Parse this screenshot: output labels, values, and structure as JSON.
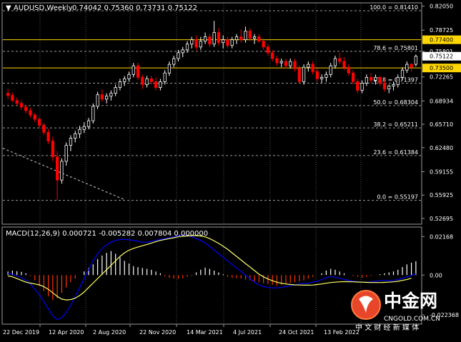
{
  "symbol_header": "AUDUSD,Weekly",
  "ohlc": "0.74042 0.75360 0.73731 0.75122",
  "fib_levels": [
    {
      "label": "100.0 = 0.81410",
      "price": 0.8141
    },
    {
      "label": "78.6 = 0.75801",
      "price": 0.75801
    },
    {
      "label": "61.8 = 0.71397",
      "price": 0.71397
    },
    {
      "label": "50.0 = 0.68304",
      "price": 0.68304
    },
    {
      "label": "38.2 = 0.65211",
      "price": 0.65211
    },
    {
      "label": "23.6 = 0.61384",
      "price": 0.61384
    },
    {
      "label": "0.0 = 0.55197",
      "price": 0.55197
    }
  ],
  "horizontal_lines": [
    {
      "price": 0.774,
      "tag": "0.77400"
    },
    {
      "price": 0.735,
      "tag": "0.73500"
    }
  ],
  "price_scale": [
    "0.82050",
    "0.78725",
    "0.75801",
    "0.72265",
    "0.68934",
    "0.65710",
    "0.62480",
    "0.59155",
    "0.55925",
    "0.52695"
  ],
  "current_price": "0.75122",
  "macd_header": "MACD(12,26,9) 0.000721 -0.005282 0.007804 0.000000",
  "macd_scale": [
    "0.02168",
    "0.00",
    "-0.022368"
  ],
  "time_labels": [
    "22 Dec 2019",
    "12 Apr 2020",
    "2 Aug 2020",
    "22 Nov 2020",
    "14 Mar 2021",
    "4 Jul 2021",
    "24 Oct 2021",
    "13 Feb 2022"
  ],
  "watermark": {
    "brand": "中金网",
    "site": "CNGOLD.COM.CN",
    "slogan": "中 文 财 经 新 媒 体"
  },
  "colors": {
    "bull": "#ffffff",
    "bear": "#ff0000",
    "level": "#ffd700",
    "macd_line": "#0000ff",
    "signal_line": "#ffff66",
    "grid": "#555555"
  },
  "chart_data": {
    "type": "candlestick",
    "candles": [
      [
        0.7,
        0.706,
        0.692,
        0.697
      ],
      [
        0.697,
        0.701,
        0.688,
        0.69
      ],
      [
        0.69,
        0.694,
        0.683,
        0.686
      ],
      [
        0.686,
        0.69,
        0.677,
        0.681
      ],
      [
        0.681,
        0.684,
        0.672,
        0.676
      ],
      [
        0.676,
        0.68,
        0.666,
        0.67
      ],
      [
        0.67,
        0.673,
        0.66,
        0.664
      ],
      [
        0.664,
        0.667,
        0.652,
        0.656
      ],
      [
        0.656,
        0.659,
        0.642,
        0.646
      ],
      [
        0.646,
        0.651,
        0.63,
        0.634
      ],
      [
        0.634,
        0.64,
        0.606,
        0.612
      ],
      [
        0.612,
        0.62,
        0.552,
        0.58
      ],
      [
        0.58,
        0.61,
        0.575,
        0.606
      ],
      [
        0.606,
        0.632,
        0.6,
        0.628
      ],
      [
        0.628,
        0.642,
        0.62,
        0.638
      ],
      [
        0.638,
        0.648,
        0.632,
        0.644
      ],
      [
        0.644,
        0.655,
        0.638,
        0.65
      ],
      [
        0.65,
        0.66,
        0.645,
        0.654
      ],
      [
        0.654,
        0.666,
        0.65,
        0.662
      ],
      [
        0.662,
        0.686,
        0.658,
        0.682
      ],
      [
        0.682,
        0.702,
        0.678,
        0.698
      ],
      [
        0.698,
        0.705,
        0.688,
        0.692
      ],
      [
        0.692,
        0.7,
        0.686,
        0.696
      ],
      [
        0.696,
        0.704,
        0.69,
        0.7
      ],
      [
        0.7,
        0.712,
        0.696,
        0.708
      ],
      [
        0.708,
        0.72,
        0.704,
        0.716
      ],
      [
        0.716,
        0.724,
        0.71,
        0.72
      ],
      [
        0.72,
        0.73,
        0.716,
        0.726
      ],
      [
        0.726,
        0.742,
        0.722,
        0.738
      ],
      [
        0.738,
        0.742,
        0.718,
        0.722
      ],
      [
        0.722,
        0.726,
        0.706,
        0.712
      ],
      [
        0.712,
        0.724,
        0.708,
        0.72
      ],
      [
        0.72,
        0.724,
        0.712,
        0.716
      ],
      [
        0.716,
        0.722,
        0.704,
        0.708
      ],
      [
        0.708,
        0.72,
        0.704,
        0.716
      ],
      [
        0.716,
        0.732,
        0.712,
        0.728
      ],
      [
        0.728,
        0.744,
        0.724,
        0.74
      ],
      [
        0.74,
        0.752,
        0.736,
        0.748
      ],
      [
        0.748,
        0.76,
        0.744,
        0.756
      ],
      [
        0.756,
        0.764,
        0.75,
        0.76
      ],
      [
        0.76,
        0.772,
        0.756,
        0.768
      ],
      [
        0.768,
        0.778,
        0.762,
        0.774
      ],
      [
        0.774,
        0.78,
        0.76,
        0.764
      ],
      [
        0.764,
        0.778,
        0.76,
        0.772
      ],
      [
        0.772,
        0.784,
        0.768,
        0.778
      ],
      [
        0.778,
        0.782,
        0.764,
        0.768
      ],
      [
        0.768,
        0.8,
        0.764,
        0.784
      ],
      [
        0.784,
        0.79,
        0.766,
        0.77
      ],
      [
        0.77,
        0.78,
        0.762,
        0.774
      ],
      [
        0.774,
        0.778,
        0.762,
        0.766
      ],
      [
        0.766,
        0.778,
        0.762,
        0.774
      ],
      [
        0.774,
        0.782,
        0.768,
        0.778
      ],
      [
        0.778,
        0.788,
        0.77,
        0.774
      ],
      [
        0.774,
        0.792,
        0.77,
        0.786
      ],
      [
        0.786,
        0.79,
        0.772,
        0.776
      ],
      [
        0.776,
        0.782,
        0.768,
        0.778
      ],
      [
        0.778,
        0.782,
        0.77,
        0.772
      ],
      [
        0.772,
        0.776,
        0.76,
        0.764
      ],
      [
        0.764,
        0.768,
        0.752,
        0.756
      ],
      [
        0.756,
        0.76,
        0.744,
        0.748
      ],
      [
        0.748,
        0.752,
        0.738,
        0.742
      ],
      [
        0.742,
        0.748,
        0.736,
        0.744
      ],
      [
        0.744,
        0.748,
        0.734,
        0.738
      ],
      [
        0.738,
        0.748,
        0.734,
        0.744
      ],
      [
        0.744,
        0.748,
        0.73,
        0.734
      ],
      [
        0.734,
        0.738,
        0.714,
        0.716
      ],
      [
        0.716,
        0.74,
        0.712,
        0.736
      ],
      [
        0.736,
        0.744,
        0.73,
        0.74
      ],
      [
        0.74,
        0.744,
        0.726,
        0.73
      ],
      [
        0.73,
        0.734,
        0.716,
        0.72
      ],
      [
        0.72,
        0.726,
        0.714,
        0.722
      ],
      [
        0.722,
        0.73,
        0.716,
        0.726
      ],
      [
        0.726,
        0.742,
        0.722,
        0.738
      ],
      [
        0.738,
        0.752,
        0.734,
        0.748
      ],
      [
        0.748,
        0.756,
        0.74,
        0.744
      ],
      [
        0.744,
        0.75,
        0.732,
        0.736
      ],
      [
        0.736,
        0.74,
        0.724,
        0.728
      ],
      [
        0.728,
        0.732,
        0.712,
        0.716
      ],
      [
        0.716,
        0.72,
        0.7,
        0.704
      ],
      [
        0.704,
        0.718,
        0.7,
        0.714
      ],
      [
        0.714,
        0.726,
        0.71,
        0.722
      ],
      [
        0.722,
        0.728,
        0.714,
        0.718
      ],
      [
        0.718,
        0.726,
        0.712,
        0.722
      ],
      [
        0.722,
        0.724,
        0.71,
        0.714
      ],
      [
        0.714,
        0.72,
        0.702,
        0.706
      ],
      [
        0.706,
        0.712,
        0.7,
        0.71
      ],
      [
        0.71,
        0.716,
        0.704,
        0.712
      ],
      [
        0.712,
        0.726,
        0.708,
        0.722
      ],
      [
        0.722,
        0.736,
        0.718,
        0.732
      ],
      [
        0.732,
        0.744,
        0.728,
        0.74
      ],
      [
        0.74,
        0.742,
        0.73,
        0.736
      ],
      [
        0.74,
        0.7536,
        0.7373,
        0.7512
      ]
    ],
    "price_range": [
      0.52,
      0.824
    ],
    "trend_line": {
      "from": [
        0,
        0.624
      ],
      "to": [
        26,
        0.553
      ]
    },
    "macd": {
      "histogram": [
        0.002,
        0.0025,
        0.0022,
        0.0018,
        0.001,
        -0.0005,
        -0.003,
        -0.006,
        -0.009,
        -0.012,
        -0.014,
        -0.013,
        -0.01,
        -0.007,
        -0.004,
        -0.002,
        0.0,
        0.002,
        0.004,
        0.006,
        0.009,
        0.011,
        0.0125,
        0.0135,
        0.012,
        0.01,
        0.008,
        0.0065,
        0.005,
        0.0045,
        0.004,
        0.0035,
        0.003,
        0.002,
        0.001,
        -0.0008,
        -0.0015,
        -0.002,
        -0.0022,
        -0.0018,
        -0.001,
        -0.0005,
        0.0015,
        0.003,
        0.0042,
        0.0035,
        0.0025,
        0.0015,
        0.0005,
        -0.001,
        -0.0015,
        -0.0018,
        -0.002,
        -0.0025,
        -0.003,
        -0.0035,
        -0.004,
        -0.0045,
        -0.005,
        -0.0055,
        -0.006,
        -0.0055,
        -0.005,
        -0.0045,
        -0.004,
        -0.0035,
        -0.003,
        -0.002,
        -0.001,
        0.0,
        0.001,
        0.0025,
        0.0035,
        0.003,
        0.002,
        0.001,
        0.0,
        -0.0005,
        -0.001,
        -0.0015,
        -0.001,
        -0.0005,
        0.0,
        0.0005,
        0.001,
        0.0015,
        0.002,
        0.003,
        0.0045,
        0.006,
        0.007,
        0.0078
      ],
      "macd_line": [
        0.001,
        0.0005,
        -0.0005,
        -0.0015,
        -0.003,
        -0.005,
        -0.008,
        -0.011,
        -0.015,
        -0.019,
        -0.023,
        -0.025,
        -0.024,
        -0.021,
        -0.017,
        -0.012,
        -0.007,
        -0.002,
        0.003,
        0.008,
        0.012,
        0.015,
        0.017,
        0.0185,
        0.0195,
        0.02,
        0.02,
        0.0198,
        0.0195,
        0.019,
        0.0185,
        0.0185,
        0.019,
        0.0195,
        0.02,
        0.0205,
        0.021,
        0.0215,
        0.022,
        0.0225,
        0.0222,
        0.0215,
        0.0205,
        0.0195,
        0.018,
        0.016,
        0.014,
        0.012,
        0.01,
        0.008,
        0.006,
        0.004,
        0.002,
        0.0,
        -0.002,
        -0.004,
        -0.0055,
        -0.0065,
        -0.007,
        -0.0072,
        -0.0072,
        -0.007,
        -0.0065,
        -0.006,
        -0.0055,
        -0.005,
        -0.0048,
        -0.0045,
        -0.004,
        -0.0035,
        -0.0025,
        -0.0015,
        -0.001,
        -0.0012,
        -0.0018,
        -0.0025,
        -0.003,
        -0.0035,
        -0.0038,
        -0.004,
        -0.004,
        -0.0038,
        -0.0035,
        -0.003,
        -0.003,
        -0.0032,
        -0.003,
        -0.0025,
        -0.0018,
        -0.001,
        -0.0002,
        0.0007
      ],
      "signal_line": [
        -0.0005,
        -0.001,
        -0.002,
        -0.003,
        -0.004,
        -0.0045,
        -0.005,
        -0.0055,
        -0.0065,
        -0.008,
        -0.01,
        -0.012,
        -0.0135,
        -0.014,
        -0.0138,
        -0.013,
        -0.0115,
        -0.0095,
        -0.007,
        -0.0045,
        -0.002,
        0.0005,
        0.003,
        0.0055,
        0.008,
        0.0105,
        0.0125,
        0.014,
        0.015,
        0.0158,
        0.0165,
        0.0172,
        0.018,
        0.0188,
        0.0195,
        0.02,
        0.0205,
        0.021,
        0.0215,
        0.0218,
        0.022,
        0.0222,
        0.0222,
        0.022,
        0.0215,
        0.0205,
        0.0192,
        0.0178,
        0.0162,
        0.0145,
        0.0125,
        0.0105,
        0.0085,
        0.0065,
        0.0045,
        0.0025,
        0.0005,
        -0.001,
        -0.0022,
        -0.0032,
        -0.004,
        -0.0046,
        -0.005,
        -0.0053,
        -0.0055,
        -0.0056,
        -0.0057,
        -0.0057,
        -0.0056,
        -0.0053,
        -0.005,
        -0.0046,
        -0.0042,
        -0.004,
        -0.0038,
        -0.0037,
        -0.0037,
        -0.0038,
        -0.0039,
        -0.004,
        -0.0041,
        -0.0042,
        -0.0042,
        -0.0042,
        -0.0041,
        -0.004,
        -0.0038,
        -0.0035,
        -0.003,
        -0.0025,
        -0.0018,
        -0.0053
      ],
      "range": [
        -0.0268,
        0.0262
      ]
    }
  }
}
